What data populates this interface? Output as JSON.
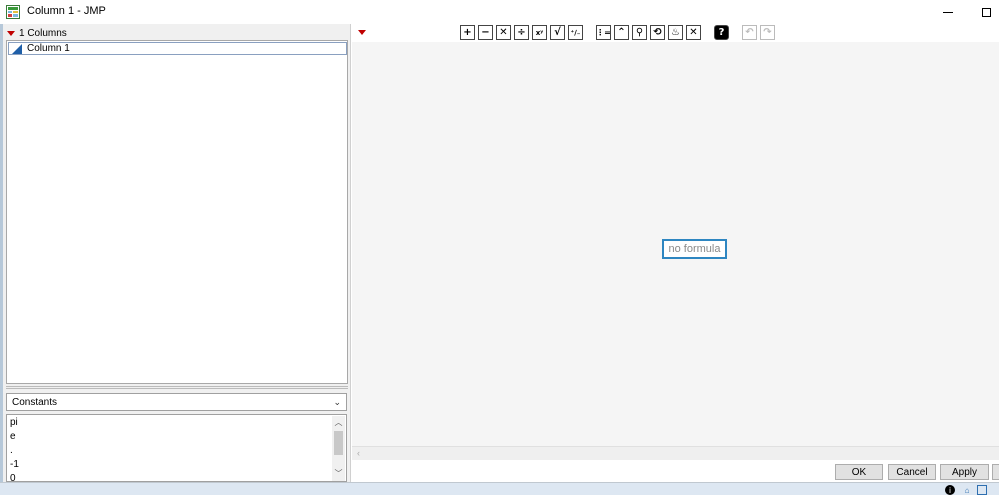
{
  "window": {
    "title": "Column 1 - JMP"
  },
  "columns_panel": {
    "header": "1 Columns",
    "items": [
      {
        "label": "Column 1",
        "icon": "continuous-icon"
      }
    ]
  },
  "functions_panel": {
    "category": "Constants",
    "items": [
      "pi",
      "e",
      ".",
      "-1",
      "0"
    ]
  },
  "formula_editor": {
    "placeholder": "no formula",
    "toolbar": [
      {
        "name": "add-icon",
        "glyph": "+"
      },
      {
        "name": "subtract-icon",
        "glyph": "−"
      },
      {
        "name": "multiply-icon",
        "glyph": "✕"
      },
      {
        "name": "divide-icon",
        "glyph": "÷"
      },
      {
        "name": "power-icon",
        "glyph": "xʸ"
      },
      {
        "name": "root-icon",
        "glyph": "√"
      },
      {
        "name": "negate-icon",
        "glyph": "⁺∕₋"
      },
      {
        "name": "list-icon",
        "glyph": "⋮="
      },
      {
        "name": "peel-icon",
        "glyph": "⌃"
      },
      {
        "name": "local-icon",
        "glyph": "⚲"
      },
      {
        "name": "swap-icon",
        "glyph": "⟲"
      },
      {
        "name": "unthrow-icon",
        "glyph": "♨"
      },
      {
        "name": "delete-icon",
        "glyph": "✕"
      }
    ],
    "help_glyph": "?",
    "undo_glyph": "↶",
    "redo_glyph": "↷"
  },
  "buttons": {
    "ok": "OK",
    "cancel": "Cancel",
    "apply": "Apply"
  },
  "colors": {
    "accent": "#2e86c1",
    "menu_triangle": "#c00000"
  }
}
